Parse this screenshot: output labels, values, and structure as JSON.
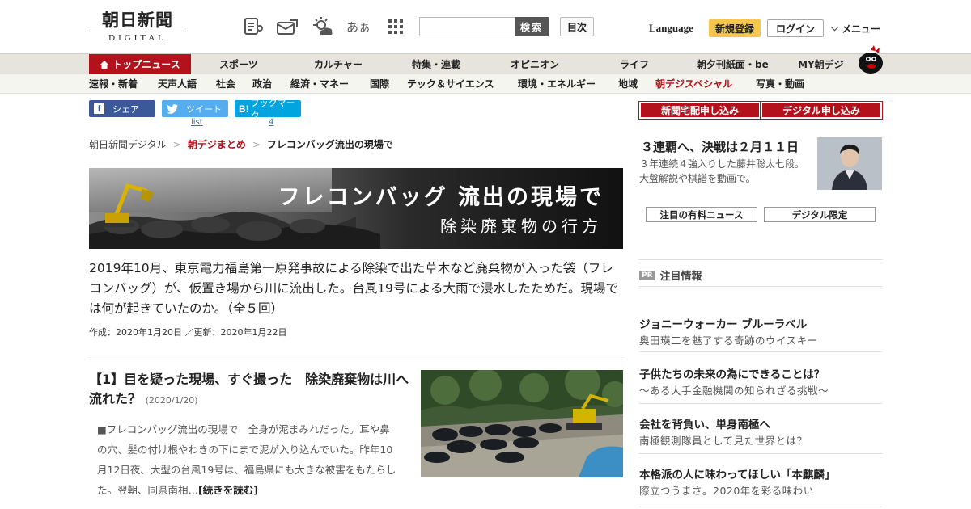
{
  "header": {
    "logo_main": "朝日新聞",
    "logo_sub": "DIGITAL",
    "search_placeholder": "",
    "search_button": "検索",
    "toc_button": "目次",
    "language": "Language",
    "register": "新規登録",
    "login": "ログイン",
    "menu": "メニュー",
    "icons": [
      "newspaper-icon",
      "mail-icon",
      "weather-icon",
      "font-size-icon",
      "grid-menu-icon"
    ],
    "font_size_label": "あぁ"
  },
  "nav_primary": {
    "items": [
      {
        "label": "トップニュース"
      },
      {
        "label": "スポーツ"
      },
      {
        "label": "カルチャー"
      },
      {
        "label": "特集・連載"
      },
      {
        "label": "オピニオン"
      },
      {
        "label": "ライフ"
      },
      {
        "label": "朝夕刊紙面・be"
      },
      {
        "label": "MY朝デジ"
      }
    ]
  },
  "nav_secondary": {
    "items": [
      {
        "label": "速報・新着"
      },
      {
        "label": "天声人語"
      },
      {
        "label": "社会"
      },
      {
        "label": "政治"
      },
      {
        "label": "経済・マネー"
      },
      {
        "label": "国際"
      },
      {
        "label": "テック＆サイエンス"
      },
      {
        "label": "環境・エネルギー"
      },
      {
        "label": "地域"
      },
      {
        "label": "朝デジスペシャル"
      },
      {
        "label": "写真・動画"
      }
    ]
  },
  "share": {
    "facebook": "シェア",
    "twitter": "ツイート",
    "twitter_count": "list",
    "hatena": "ブックマーク",
    "hatena_count": "4"
  },
  "breadcrumb": {
    "items": [
      "朝日新聞デジタル",
      "朝デジまとめ",
      "フレコンバッグ流出の現場で"
    ]
  },
  "banner": {
    "title": "フレコンバッグ 流出の現場で",
    "subtitle": "除染廃棄物の行方"
  },
  "lead": "2019年10月、東京電力福島第一原発事故による除染で出た草木など廃棄物が入った袋（フレコンバッグ）が、仮置き場から川に流出した。台風19号による大雨で浸水したためだ。現場では何が起きていたのか。（全５回）",
  "dates": "作成：2020年1月20日 ／更新：2020年1月22日",
  "article": {
    "title": "【1】目を疑った現場、すぐ撮った　除染廃棄物は川へ流れた？",
    "date": "(2020/1/20)",
    "body": "■フレコンバッグ流出の現場で　全身が泥まみれだった。耳や鼻の穴、髪の付け根やわきの下にまで泥が入り込んでいた。昨年10月12日夜、大型の台風19号は、福島県にも大きな被害をもたらした。翌朝、同県南相…",
    "more": "[続きを読む]"
  },
  "sidebar": {
    "subscribe_paper": "新聞宅配申し込み",
    "subscribe_digital": "デジタル申し込み",
    "promo_title": "３連覇へ、決戦は２月１１日",
    "promo_desc": "３年連続４強入りした藤井聡太七段。大盤解説や棋譜を動画で。",
    "btn_paid": "注目の有料ニュース",
    "btn_digital": "デジタル限定",
    "pr_badge": "PR",
    "pr_heading": "注目情報",
    "pr_items": [
      {
        "title": "ジョニーウォーカー ブルーラベル",
        "sub": "奥田瑛二を魅了する奇跡のウイスキー"
      },
      {
        "title": "子供たちの未来の為にできることは？",
        "sub": "～ある大手金融機関の知られざる挑戦～"
      },
      {
        "title": "会社を背負い、単身南極へ",
        "sub": "南極観測隊員として見た世界とは？"
      },
      {
        "title": "本格派の人に味わってほしい「本麒麟」",
        "sub": "際立つうまさ。2020年を彩る味わい"
      }
    ]
  },
  "colors": {
    "brand_red": "#b3121c",
    "register_yellow": "#f5c84c",
    "facebook": "#3b5998",
    "twitter": "#55acee",
    "hatena": "#00a4de"
  }
}
